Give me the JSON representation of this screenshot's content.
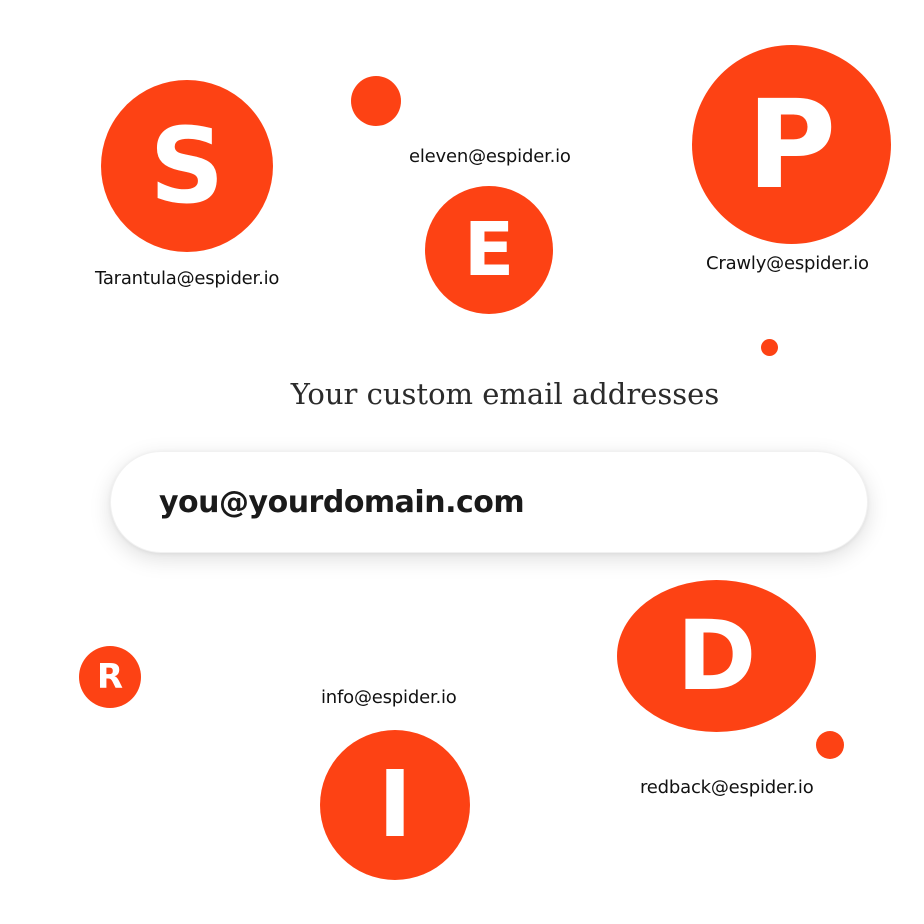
{
  "accent_color": "#fd4214",
  "heading": "Your custom email addresses",
  "email_input": {
    "value": "",
    "placeholder": "you@yourdomain.com"
  },
  "letters": {
    "s": "S",
    "e": "E",
    "p": "P",
    "r": "R",
    "i": "I",
    "d": "D"
  },
  "emails": {
    "tarantula": "Tarantula@espider.io",
    "eleven": "eleven@espider.io",
    "crawly": "Crawly@espider.io",
    "info": "info@espider.io",
    "redback": "redback@espider.io"
  }
}
